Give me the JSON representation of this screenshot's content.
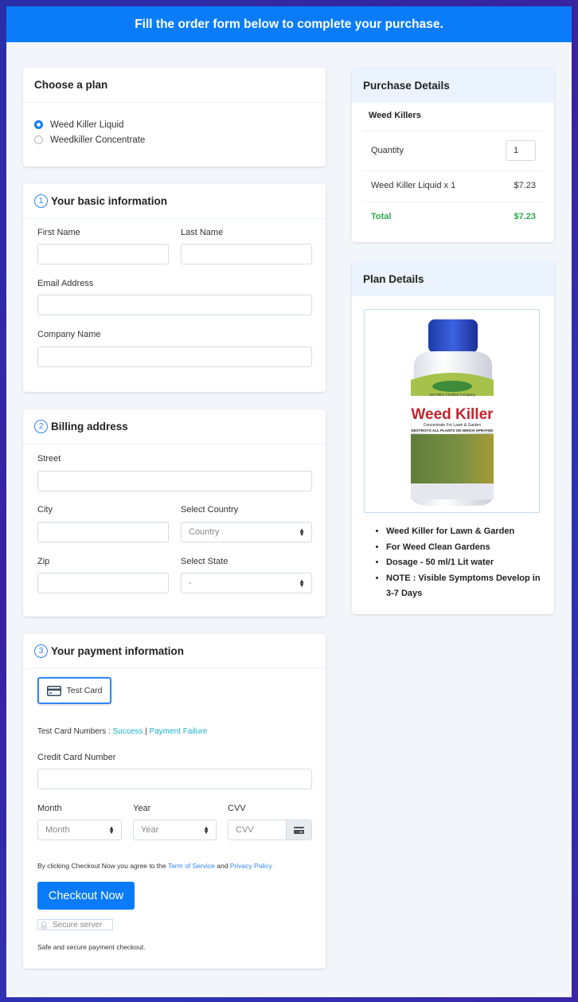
{
  "banner": {
    "title": "Fill the order form below to complete your purchase."
  },
  "plan": {
    "title": "Choose a plan",
    "options": [
      {
        "label": "Weed Killer Liquid",
        "selected": true
      },
      {
        "label": "Weedkiller Concentrate",
        "selected": false
      }
    ]
  },
  "basic_info": {
    "step": "1",
    "title": "Your basic information",
    "first_name_label": "First Name",
    "last_name_label": "Last Name",
    "email_label": "Email Address",
    "company_label": "Company Name"
  },
  "billing": {
    "step": "2",
    "title": "Billing address",
    "street_label": "Street",
    "city_label": "City",
    "country_label": "Select Country",
    "country_value": "Country",
    "zip_label": "Zip",
    "state_label": "Select State",
    "state_value": "-"
  },
  "payment": {
    "step": "3",
    "title": "Your payment information",
    "card_button": "Test Card",
    "test_numbers_label": "Test Card Numbers :",
    "success_link": "Success",
    "separator": "|",
    "failure_link": "Payment Failure",
    "cc_label": "Credit Card Number",
    "month_label": "Month",
    "month_value": "Month",
    "year_label": "Year",
    "year_value": "Year",
    "cvv_label": "CVV",
    "cvv_placeholder": "CVV",
    "agree_prefix": "By clicking Checkout Now you agree to the",
    "terms_link": "Term of Service",
    "agree_and": "and",
    "privacy_link": "Privacy Policy",
    "checkout_button": "Checkout Now",
    "secure_badge": "Secure server",
    "safe_note": "Safe and secure payment checkout."
  },
  "purchase": {
    "title": "Purchase Details",
    "product_group": "Weed Killers",
    "quantity_label": "Quantity",
    "quantity_value": "1",
    "line_item": "Weed Killer Liquid x 1",
    "line_price": "$7.23",
    "total_label": "Total",
    "total_value": "$7.23",
    "total_color": "#2ea94b"
  },
  "plan_details": {
    "title": "Plan Details",
    "image_alt": "Weed Killer bottle",
    "label_brand": "Weed Killer",
    "label_sub": "Concentrate For Lawn & Garden",
    "label_warn": "DESTROYS ALL PLANTS ON WHICH SPRAYED",
    "label_iso": "ISO 9001 Certified Company",
    "bullets": [
      "Weed Killer for Lawn & Garden",
      "For Weed Clean Gardens",
      "Dosage - 50 ml/1 Lit water",
      "NOTE : Visible Symptoms Develop in 3-7 Days"
    ]
  }
}
